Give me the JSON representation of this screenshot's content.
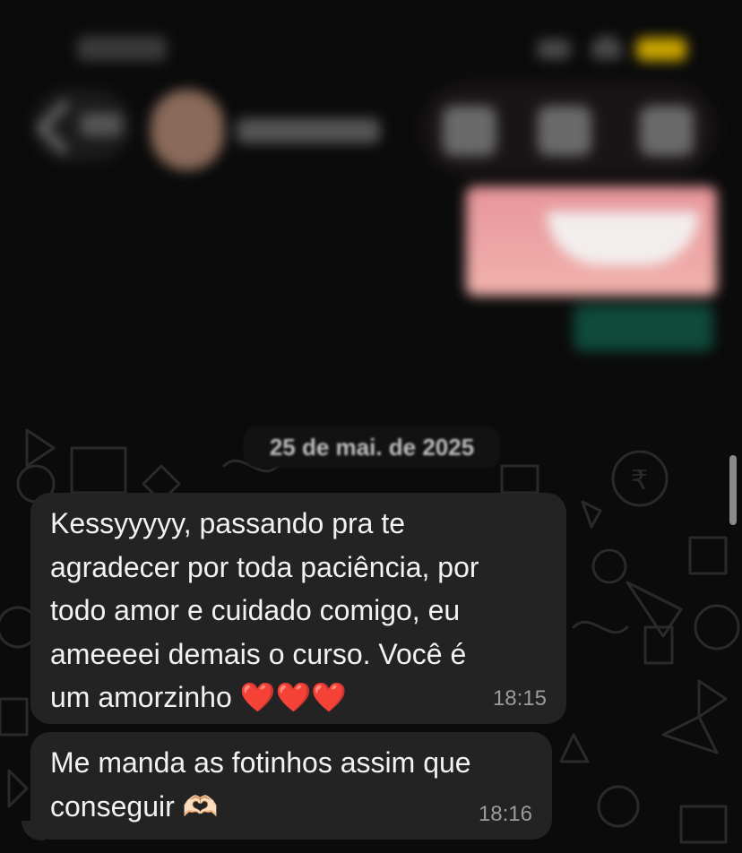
{
  "chat": {
    "date_separator": "25 de mai. de 2025",
    "messages": [
      {
        "lines": [
          "Kessyyyyy, passando pra te",
          "agradecer por toda paciência, por",
          "todo amor e cuidado comigo, eu",
          "ameeeei demais o curso. Você é",
          "um amorzinho ❤️❤️❤️"
        ],
        "time": "18:15",
        "direction": "incoming"
      },
      {
        "lines": [
          "Me manda as fotinhos assim que",
          "conseguir 🫶🏻"
        ],
        "time": "18:16",
        "direction": "incoming"
      }
    ]
  },
  "icons": {
    "header": [
      "back-chevron-icon",
      "avatar",
      "camera-icon",
      "video-icon",
      "phone-icon"
    ],
    "status": [
      "signal-icon",
      "wifi-icon",
      "battery-icon"
    ]
  },
  "colors": {
    "background": "#0b0b0b",
    "bubble_incoming": "#232323",
    "media_tint": "#e7959a",
    "timestamp": "#9b9b9b"
  }
}
